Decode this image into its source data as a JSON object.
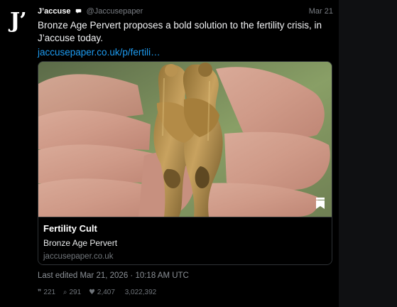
{
  "colors": {
    "background": "#000000",
    "accent": "#1d9bf0",
    "muted_text": "#7b7f85",
    "card_border": "#2f3336"
  },
  "avatar": {
    "text": "J’"
  },
  "tweet": {
    "display_name": "J’accuse",
    "verified_icon": "speech-bubble-icon",
    "handle": "@Jaccusepaper",
    "date": "Mar 21",
    "text": "Bronze Age Pervert proposes a bold solution to the fertility crisis, in J’accuse today.",
    "link": "jaccusepaper.co.uk/p/fertili…"
  },
  "card": {
    "image_icon": "bookmark-icon",
    "title": "Fertility Cult",
    "description": "Bronze Age Pervert",
    "domain": "jaccusepaper.co.uk"
  },
  "footer": {
    "edited": "Last edited Mar 21, 2026 · 10:18 AM UTC",
    "stats": [
      {
        "icon": "comment-icon",
        "value": "221"
      },
      {
        "icon": "search-icon",
        "value": "291"
      },
      {
        "icon": "heart-icon",
        "value": "2,407"
      },
      {
        "icon": "views-icon",
        "value": "3,022,392"
      }
    ]
  }
}
